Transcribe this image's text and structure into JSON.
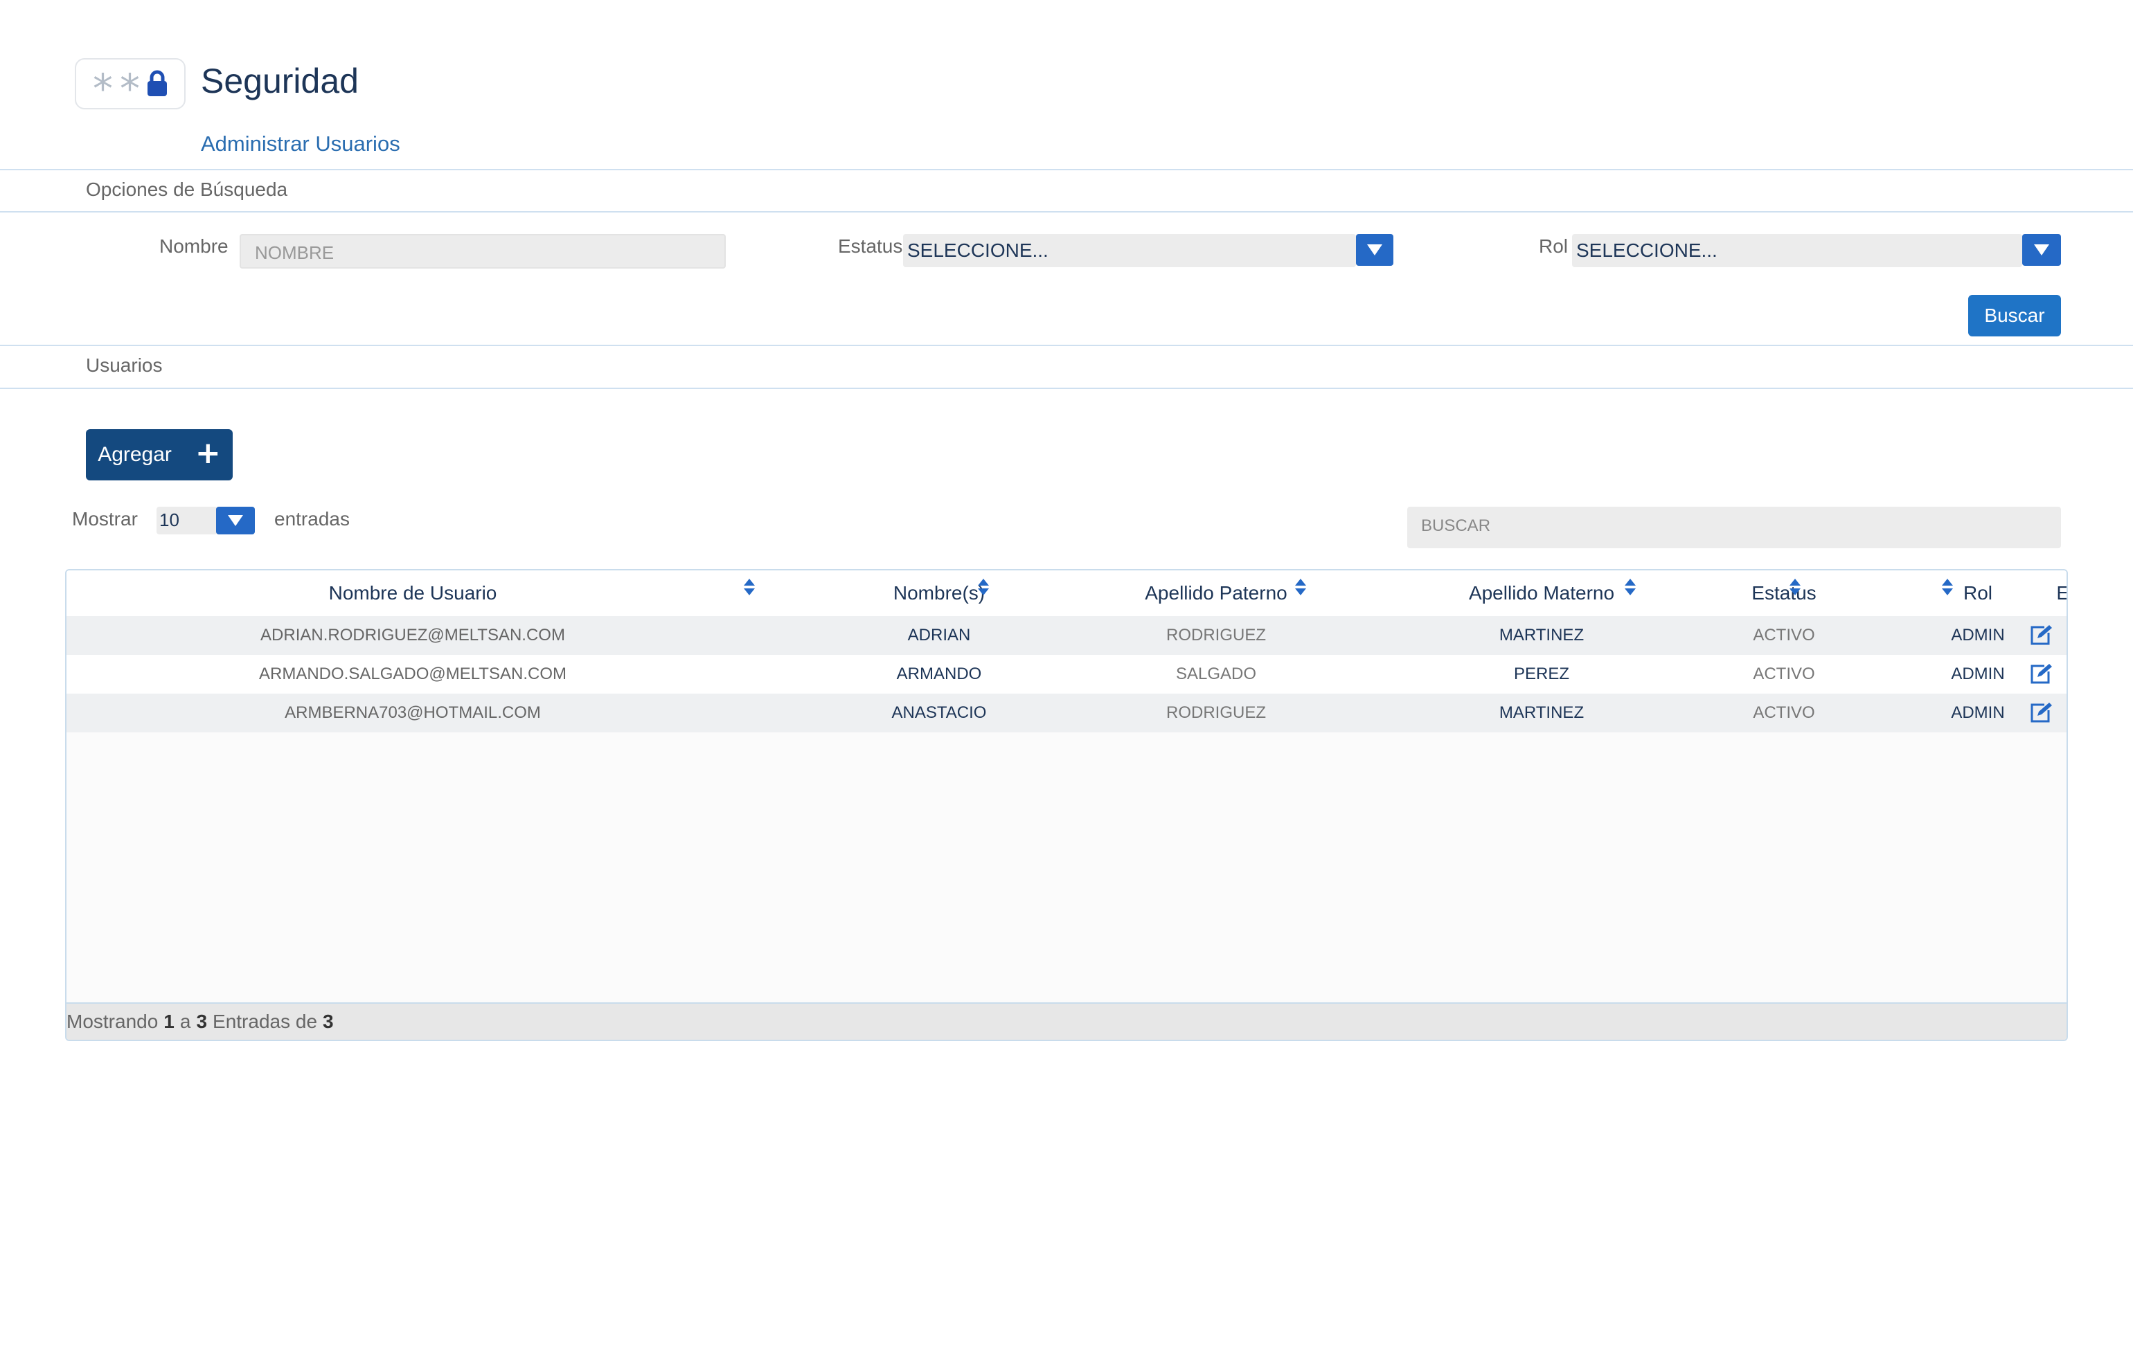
{
  "header": {
    "title": "Seguridad",
    "subtitle": "Administrar Usuarios",
    "logo_icon": "asterisk-lock-icon"
  },
  "search_section": {
    "label": "Opciones de Búsqueda",
    "nombre_label": "Nombre",
    "nombre_placeholder": "NOMBRE",
    "estatus_label": "Estatus",
    "estatus_value": "SELECCIONE...",
    "rol_label": "Rol",
    "rol_value": "SELECCIONE...",
    "search_button": "Buscar"
  },
  "users_section": {
    "label": "Usuarios",
    "add_button": "Agregar",
    "show_label": "Mostrar",
    "page_size": "10",
    "entries_label": "entradas",
    "search_placeholder": "BUSCAR"
  },
  "table": {
    "columns": [
      "Nombre de Usuario",
      "Nombre(s)",
      "Apellido Paterno",
      "Apellido Materno",
      "Estatus",
      "Rol",
      "Editar"
    ],
    "rows": [
      {
        "usuario": "ADRIAN.RODRIGUEZ@MELTSAN.COM",
        "nombre": "ADRIAN",
        "paterno": "RODRIGUEZ",
        "materno": "MARTINEZ",
        "estatus": "ACTIVO",
        "rol": "ADMIN"
      },
      {
        "usuario": "ARMANDO.SALGADO@MELTSAN.COM",
        "nombre": "ARMANDO",
        "paterno": "SALGADO",
        "materno": "PEREZ",
        "estatus": "ACTIVO",
        "rol": "ADMIN"
      },
      {
        "usuario": "ARMBERNA703@HOTMAIL.COM",
        "nombre": "ANASTACIO",
        "paterno": "RODRIGUEZ",
        "materno": "MARTINEZ",
        "estatus": "ACTIVO",
        "rol": "ADMIN"
      }
    ],
    "footer": {
      "prefix": "Mostrando",
      "from": "1",
      "sep": "a",
      "to": "3",
      "middle": "Entradas de",
      "total": "3"
    }
  },
  "colors": {
    "accent": "#2569c6",
    "dark_button": "#14497f",
    "primary_button": "#1f74c6",
    "title": "#1d3557"
  }
}
